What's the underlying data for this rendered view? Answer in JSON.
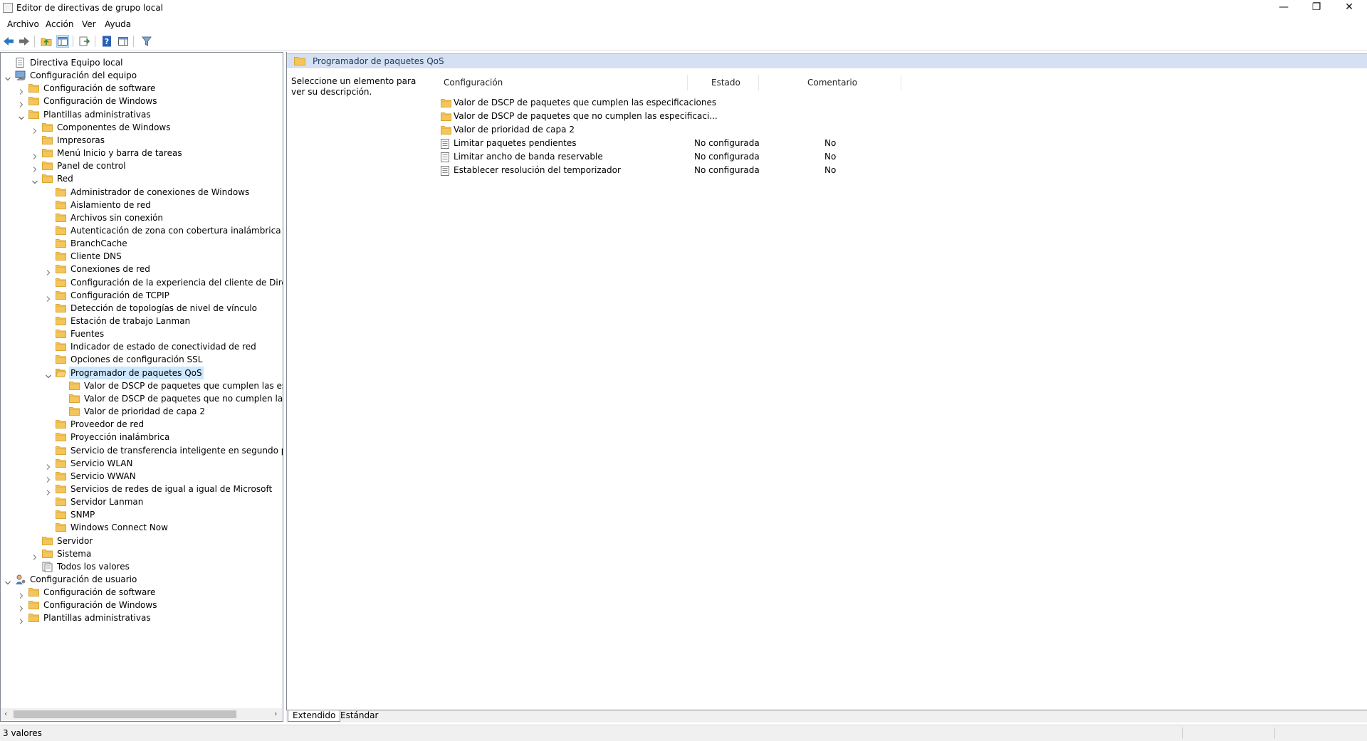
{
  "window": {
    "title": "Editor de directivas de grupo local",
    "minimize": "—",
    "restore": "❐",
    "close": "✕"
  },
  "menu": [
    "Archivo",
    "Acción",
    "Ver",
    "Ayuda"
  ],
  "toolbar_icons": [
    "back-icon",
    "forward-icon",
    "up-folder-icon",
    "show-hide-tree-icon",
    "export-list-icon",
    "help-icon",
    "properties-view-icon",
    "filter-icon"
  ],
  "tree": [
    {
      "label": "Directiva Equipo local",
      "level": 0,
      "icon": "policy",
      "exp": ""
    },
    {
      "label": "Configuración del equipo",
      "level": 0,
      "icon": "computer",
      "exp": "open"
    },
    {
      "label": "Configuración de software",
      "level": 1,
      "icon": "folder",
      "exp": "closed"
    },
    {
      "label": "Configuración de Windows",
      "level": 1,
      "icon": "folder",
      "exp": "closed"
    },
    {
      "label": "Plantillas administrativas",
      "level": 1,
      "icon": "folder",
      "exp": "open"
    },
    {
      "label": "Componentes de Windows",
      "level": 2,
      "icon": "folder",
      "exp": "closed"
    },
    {
      "label": "Impresoras",
      "level": 2,
      "icon": "folder",
      "exp": ""
    },
    {
      "label": "Menú Inicio y barra de tareas",
      "level": 2,
      "icon": "folder",
      "exp": "closed"
    },
    {
      "label": "Panel de control",
      "level": 2,
      "icon": "folder",
      "exp": "closed"
    },
    {
      "label": "Red",
      "level": 2,
      "icon": "folder",
      "exp": "open"
    },
    {
      "label": "Administrador de conexiones de Windows",
      "level": 3,
      "icon": "folder",
      "exp": ""
    },
    {
      "label": "Aislamiento de red",
      "level": 3,
      "icon": "folder",
      "exp": ""
    },
    {
      "label": "Archivos sin conexión",
      "level": 3,
      "icon": "folder",
      "exp": ""
    },
    {
      "label": "Autenticación de zona con cobertura inalámbrica",
      "level": 3,
      "icon": "folder",
      "exp": ""
    },
    {
      "label": "BranchCache",
      "level": 3,
      "icon": "folder",
      "exp": ""
    },
    {
      "label": "Cliente DNS",
      "level": 3,
      "icon": "folder",
      "exp": ""
    },
    {
      "label": "Conexiones de red",
      "level": 3,
      "icon": "folder",
      "exp": "closed"
    },
    {
      "label": "Configuración de la experiencia del cliente de DirectAcc",
      "level": 3,
      "icon": "folder",
      "exp": ""
    },
    {
      "label": "Configuración de TCPIP",
      "level": 3,
      "icon": "folder",
      "exp": "closed"
    },
    {
      "label": "Detección de topologías de nivel de vínculo",
      "level": 3,
      "icon": "folder",
      "exp": ""
    },
    {
      "label": "Estación de trabajo Lanman",
      "level": 3,
      "icon": "folder",
      "exp": ""
    },
    {
      "label": "Fuentes",
      "level": 3,
      "icon": "folder",
      "exp": ""
    },
    {
      "label": "Indicador de estado de conectividad de red",
      "level": 3,
      "icon": "folder",
      "exp": ""
    },
    {
      "label": "Opciones de configuración SSL",
      "level": 3,
      "icon": "folder",
      "exp": ""
    },
    {
      "label": "Programador de paquetes QoS",
      "level": 3,
      "icon": "folder-open",
      "exp": "open",
      "selected": true
    },
    {
      "label": "Valor de DSCP de paquetes que cumplen las especifi",
      "level": 4,
      "icon": "folder",
      "exp": ""
    },
    {
      "label": "Valor de DSCP de paquetes que no cumplen las espe",
      "level": 4,
      "icon": "folder",
      "exp": ""
    },
    {
      "label": "Valor de prioridad de capa 2",
      "level": 4,
      "icon": "folder",
      "exp": ""
    },
    {
      "label": "Proveedor de red",
      "level": 3,
      "icon": "folder",
      "exp": ""
    },
    {
      "label": "Proyección inalámbrica",
      "level": 3,
      "icon": "folder",
      "exp": ""
    },
    {
      "label": "Servicio de transferencia inteligente en segundo plano (E",
      "level": 3,
      "icon": "folder",
      "exp": ""
    },
    {
      "label": "Servicio WLAN",
      "level": 3,
      "icon": "folder",
      "exp": "closed"
    },
    {
      "label": "Servicio WWAN",
      "level": 3,
      "icon": "folder",
      "exp": "closed"
    },
    {
      "label": "Servicios de redes de igual a igual de Microsoft",
      "level": 3,
      "icon": "folder",
      "exp": "closed"
    },
    {
      "label": "Servidor Lanman",
      "level": 3,
      "icon": "folder",
      "exp": ""
    },
    {
      "label": "SNMP",
      "level": 3,
      "icon": "folder",
      "exp": ""
    },
    {
      "label": "Windows Connect Now",
      "level": 3,
      "icon": "folder",
      "exp": ""
    },
    {
      "label": "Servidor",
      "level": 2,
      "icon": "folder",
      "exp": ""
    },
    {
      "label": "Sistema",
      "level": 2,
      "icon": "folder",
      "exp": "closed"
    },
    {
      "label": "Todos los valores",
      "level": 2,
      "icon": "settings-list",
      "exp": ""
    },
    {
      "label": "Configuración de usuario",
      "level": 0,
      "icon": "user",
      "exp": "open"
    },
    {
      "label": "Configuración de software",
      "level": 1,
      "icon": "folder",
      "exp": "closed"
    },
    {
      "label": "Configuración de Windows",
      "level": 1,
      "icon": "folder",
      "exp": "closed"
    },
    {
      "label": "Plantillas administrativas",
      "level": 1,
      "icon": "folder",
      "exp": "closed"
    }
  ],
  "right": {
    "header_title": "Programador de paquetes QoS",
    "description": "Seleccione un elemento para ver su descripción.",
    "columns": {
      "config": "Configuración",
      "state": "Estado",
      "comment": "Comentario"
    },
    "rows": [
      {
        "icon": "folder",
        "name": "Valor de DSCP de paquetes que cumplen las especificaciones",
        "state": "",
        "comment": ""
      },
      {
        "icon": "folder",
        "name": "Valor de DSCP de paquetes que no cumplen las especificaci...",
        "state": "",
        "comment": ""
      },
      {
        "icon": "folder",
        "name": "Valor de prioridad de capa 2",
        "state": "",
        "comment": ""
      },
      {
        "icon": "setting",
        "name": "Limitar paquetes pendientes",
        "state": "No configurada",
        "comment": "No"
      },
      {
        "icon": "setting",
        "name": "Limitar ancho de banda reservable",
        "state": "No configurada",
        "comment": "No"
      },
      {
        "icon": "setting",
        "name": "Establecer resolución del temporizador",
        "state": "No configurada",
        "comment": "No"
      }
    ]
  },
  "tabs": {
    "extended": "Extendido",
    "standard": "Estándar"
  },
  "status": "3 valores",
  "colors": {
    "folder": "#f4c55b",
    "folder_edge": "#d9a630",
    "selection": "#cce8ff",
    "header_bg": "#d5e1f2",
    "arrow_blue": "#2b78c5"
  }
}
